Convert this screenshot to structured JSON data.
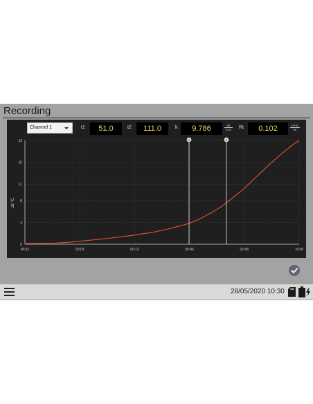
{
  "header": {
    "title": "Recording"
  },
  "controls": {
    "channel": {
      "selected": "Channel 1"
    },
    "t1": {
      "label": "t1",
      "value": "51.0"
    },
    "t2": {
      "label": "t2",
      "value": "111.0"
    },
    "k": {
      "label": "k",
      "value": "9.786",
      "unit_top": "W",
      "unit_bottom": "m·K"
    },
    "rt": {
      "label": "Rt",
      "value": "0.102",
      "unit_top": "m²·K",
      "unit_bottom": "W"
    }
  },
  "chart_data": {
    "type": "line",
    "ylabel": "Δt °C",
    "y_ticks": [
      "0",
      "4",
      "8",
      "11",
      "15",
      "19"
    ],
    "ylim": [
      0,
      19
    ],
    "x_ticks": [
      "00:01",
      "00:03",
      "00:12",
      "00:46",
      "02:46",
      "10:00"
    ],
    "x_scale": "log",
    "grid": true,
    "series": [
      {
        "color": "#e8522a",
        "x": [
          1,
          1.5,
          2,
          3,
          5,
          8,
          12,
          20,
          30,
          46,
          60,
          80,
          100,
          130,
          166,
          220,
          300,
          400,
          500,
          600
        ],
        "y": [
          0.1,
          0.15,
          0.2,
          0.4,
          0.8,
          1.2,
          1.6,
          2.2,
          2.9,
          3.8,
          4.7,
          5.9,
          7.0,
          8.6,
          10.2,
          12.3,
          14.6,
          16.6,
          18.0,
          19.0
        ]
      }
    ],
    "cursors": [
      {
        "label": "1",
        "x": 46
      },
      {
        "label": "2",
        "x": 110
      }
    ],
    "colors": {
      "background": "#1f1f1f",
      "grid": "#4a4a4a",
      "axis": "#d0d0d0"
    }
  },
  "footer": {
    "datetime": "28/05/2020 10:30",
    "menu_icon": "hamburger-menu-icon",
    "sd_icon": "sd-card-icon",
    "battery_icon": "battery-charging-icon",
    "confirm_icon": "checkmark-icon"
  }
}
